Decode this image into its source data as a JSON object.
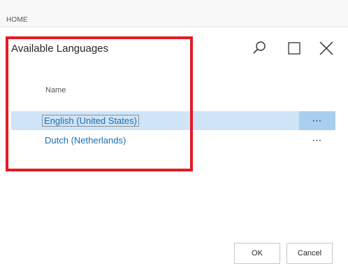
{
  "topbar": {
    "label": "HOME"
  },
  "dialog": {
    "title": "Available Languages",
    "icons": [
      "search-icon",
      "maximize-icon",
      "close-icon"
    ]
  },
  "list": {
    "column_header": "Name",
    "rows": [
      {
        "label": "English (United States)",
        "selected": true,
        "menu": "⋯"
      },
      {
        "label": "Dutch (Netherlands)",
        "selected": false,
        "menu": "⋯"
      }
    ]
  },
  "buttons": {
    "ok": "OK",
    "cancel": "Cancel"
  },
  "colors": {
    "accent_text": "#1d6fb0",
    "selected_row": "#cfe4f7",
    "selected_menu": "#a9cfee",
    "highlight_border": "#e31b23"
  }
}
